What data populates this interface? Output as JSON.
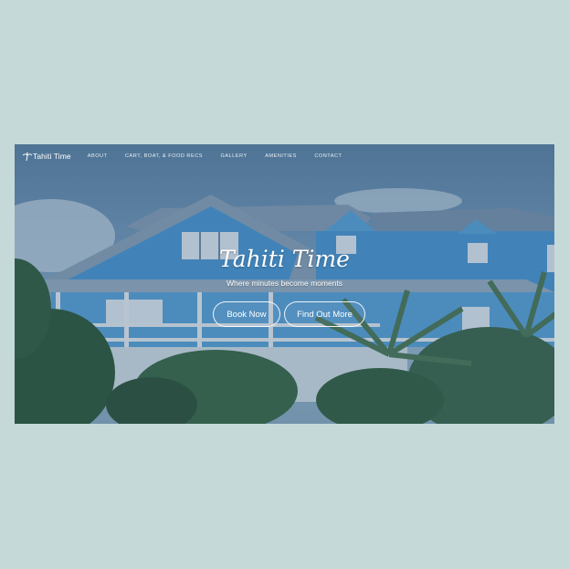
{
  "brand": {
    "name": "Tahiti Time",
    "icon": "palm-tree-icon"
  },
  "nav": {
    "items": [
      {
        "label": "ABOUT"
      },
      {
        "label": "CART, BOAT, & FOOD RECS"
      },
      {
        "label": "GALLERY"
      },
      {
        "label": "AMENITIES"
      },
      {
        "label": "CONTACT"
      }
    ]
  },
  "hero": {
    "title": "Tahiti Time",
    "subtitle": "Where minutes become moments",
    "primary_button": "Book Now",
    "secondary_button": "Find Out More"
  },
  "colors": {
    "page_background": "#c5d9d8",
    "house_blue": "#5aa8e0",
    "overlay": "#284664",
    "text": "#ffffff"
  }
}
